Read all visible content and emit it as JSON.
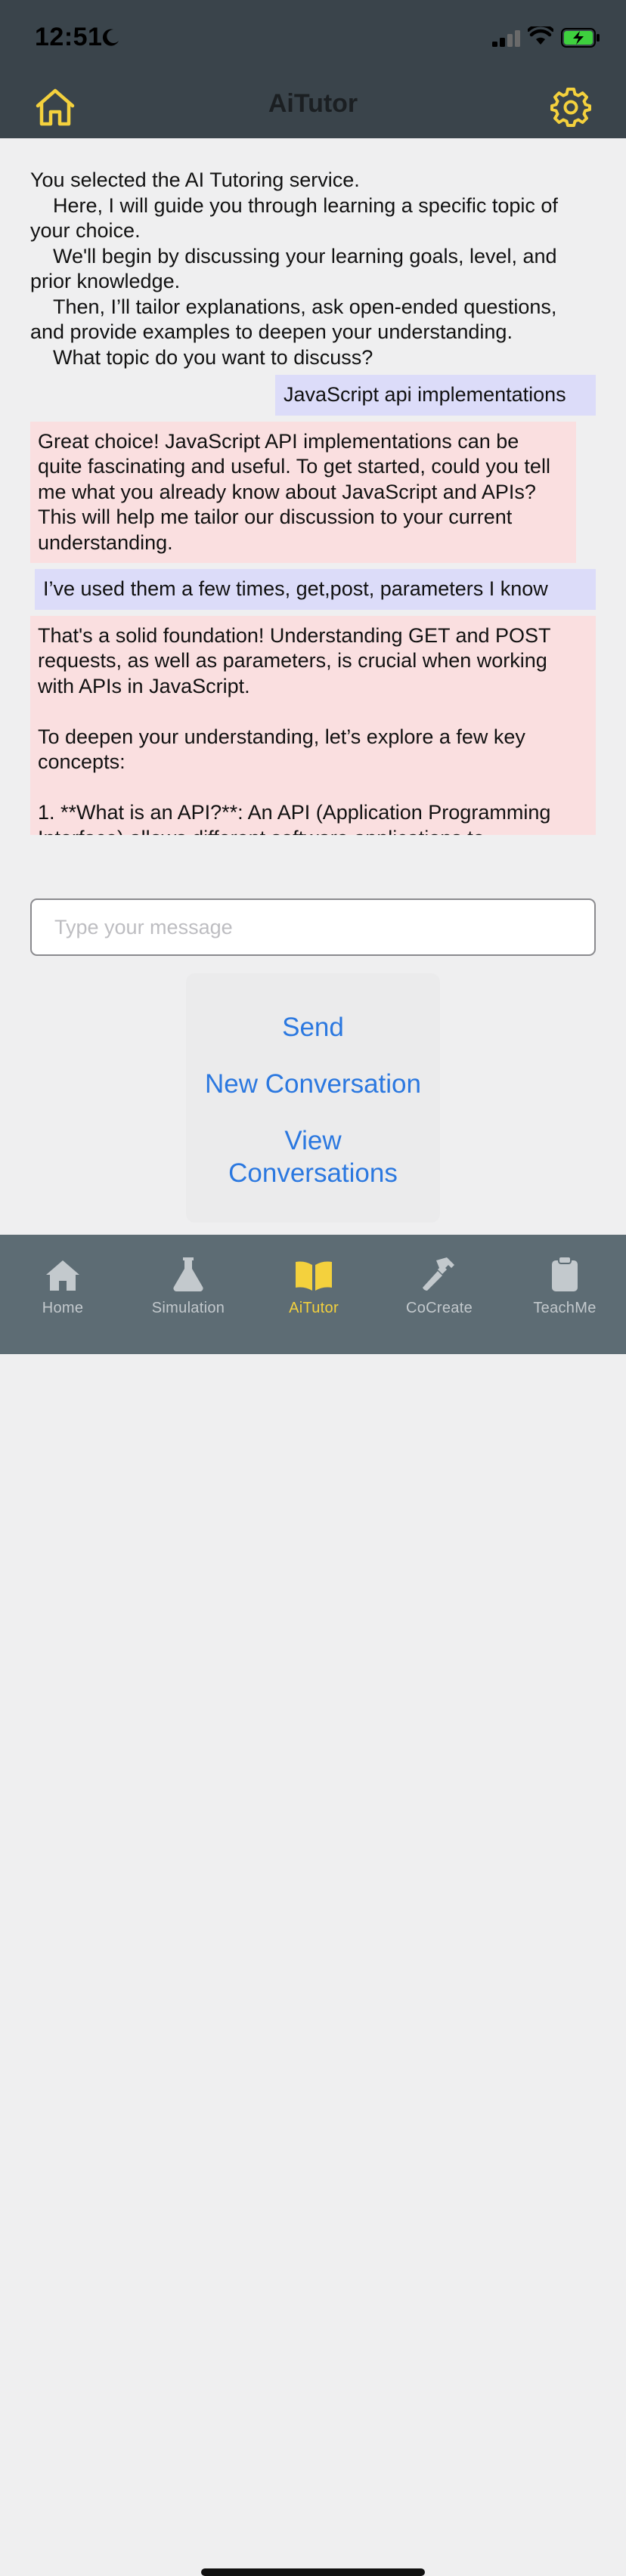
{
  "status_bar": {
    "time": "12:51"
  },
  "header": {
    "title": "AiTutor"
  },
  "chat": {
    "intro": "You selected the AI Tutoring service.\n    Here, I will guide you through learning a specific topic of your choice.\n    We'll begin by discussing your learning goals, level, and prior knowledge.\n    Then, I’ll tailor explanations, ask open-ended questions, and provide examples to deepen your understanding.\n    What topic do you want to discuss?",
    "messages": [
      {
        "role": "user",
        "text": "JavaScript api implementations"
      },
      {
        "role": "assistant",
        "text": "Great choice! JavaScript API implementations can be quite fascinating and useful. To get started, could you tell me what you already know about JavaScript and APIs? This will help me tailor our discussion to your current understanding."
      },
      {
        "role": "user",
        "text": "I’ve used them a few times, get,post, parameters I know"
      },
      {
        "role": "assistant",
        "text": "That's a solid foundation! Understanding GET and POST requests, as well as parameters, is crucial when working with APIs in JavaScript.\n\nTo deepen your understanding, let’s explore a few key concepts:\n\n1. **What is an API?**: An API (Application Programming Interface) allows different software applications to"
      }
    ]
  },
  "composer": {
    "placeholder": "Type your message",
    "value": ""
  },
  "actions": {
    "send": "Send",
    "new_conversation": "New Conversation",
    "view_conversations": "View\nConversations"
  },
  "tabs": [
    {
      "label": "Home",
      "icon": "house-icon",
      "active": false
    },
    {
      "label": "Simulation",
      "icon": "flask-icon",
      "active": false
    },
    {
      "label": "AiTutor",
      "icon": "open-book-icon",
      "active": true
    },
    {
      "label": "CoCreate",
      "icon": "hammer-icon",
      "active": false
    },
    {
      "label": "TeachMe",
      "icon": "clipboard-icon",
      "active": false
    }
  ],
  "colors": {
    "header_bg": "#3a444b",
    "accent_yellow": "#f4d13d",
    "link_blue": "#2b78e0",
    "user_bubble": "#dcdcf9",
    "assistant_bubble": "#fadfe0",
    "tabbar_bg": "#5d6c74",
    "battery_green": "#3ed03e"
  }
}
